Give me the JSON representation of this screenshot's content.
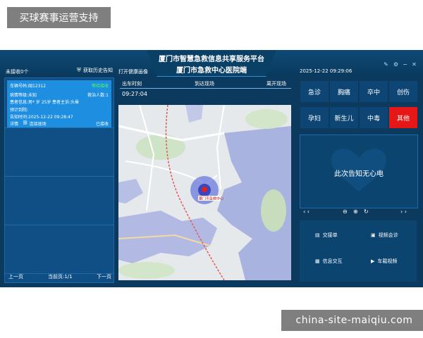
{
  "watermark_top": "买球赛事运营支持",
  "watermark_bottom": "china-site-maiqiu.com",
  "header": {
    "title_line1": "厦门市智慧急救信息共享服务平台",
    "title_line2": "厦门市急救中心医院端",
    "left_status": "未接收0个",
    "history_btn": "获取历史告知",
    "open_map": "打开健康画像",
    "datetime": "2025-12-22 09:29:06"
  },
  "card": {
    "plate": "车辆号码:闽12312",
    "status": "等待接收",
    "symptom": "病情等级:未知",
    "count": "救治人数:1",
    "patient": "患者信息:男* 岁 25岁",
    "chief": "患者主诉:头晕",
    "initial": "预计到院:",
    "notify_time": "告知时间:2025-12-22 09:28:47",
    "detail": "详情",
    "contact": "连接现场",
    "unfinished": "已接收"
  },
  "pager": {
    "prev": "上一页",
    "page": "当前页:1/1",
    "next": "下一页"
  },
  "mid": {
    "col1": "出车时刻",
    "col2": "到达现场",
    "col3": "离开现场",
    "time": "09:27:04",
    "marker_label": "厦门市急救中心"
  },
  "categories": [
    {
      "label": "急诊",
      "selected": false
    },
    {
      "label": "胸痛",
      "selected": false
    },
    {
      "label": "卒中",
      "selected": false
    },
    {
      "label": "创伤",
      "selected": false
    },
    {
      "label": "孕妇",
      "selected": false
    },
    {
      "label": "新生儿",
      "selected": false
    },
    {
      "label": "中毒",
      "selected": false
    },
    {
      "label": "其他",
      "selected": true
    }
  ],
  "ecg": {
    "message": "此次告知无心电"
  },
  "actions": {
    "handover": "交接单",
    "video": "视频会诊",
    "info": "信息交互",
    "vehicle_video": "车载视频"
  },
  "colors": {
    "accent_red": "#e51717",
    "panel": "#0b3a5e",
    "card": "#1e8fe0",
    "status_green": "#4dff5a"
  }
}
